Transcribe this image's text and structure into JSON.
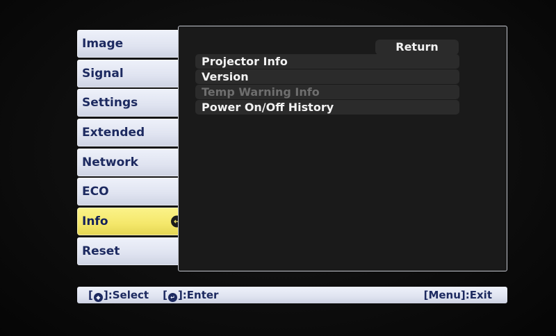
{
  "menu": {
    "items": [
      {
        "label": "Image"
      },
      {
        "label": "Signal"
      },
      {
        "label": "Settings"
      },
      {
        "label": "Extended"
      },
      {
        "label": "Network"
      },
      {
        "label": "ECO"
      },
      {
        "label": "Info",
        "selected": true,
        "icon": "enter-icon"
      },
      {
        "label": "Reset"
      }
    ]
  },
  "panel": {
    "return_label": "Return",
    "rows": [
      {
        "label": "Projector Info",
        "enabled": true
      },
      {
        "label": "Version",
        "enabled": true
      },
      {
        "label": "Temp Warning Info",
        "enabled": false
      },
      {
        "label": "Power On/Off History",
        "enabled": true
      }
    ]
  },
  "helpbar": {
    "select_open": "[",
    "select_close": "]:Select",
    "enter_open": "[",
    "enter_close": "]:Enter",
    "exit": "[Menu]:Exit",
    "select_icon": "up-down-arrow-icon",
    "enter_icon": "enter-icon"
  },
  "colors": {
    "selected_tab": "#f4e76a",
    "menu_tab": "#dfe3f0",
    "menu_text": "#1d2a60",
    "panel_bg": "#1a1a1a",
    "row_bg": "#2b2b2b",
    "disabled_text": "#6e6e6e"
  }
}
